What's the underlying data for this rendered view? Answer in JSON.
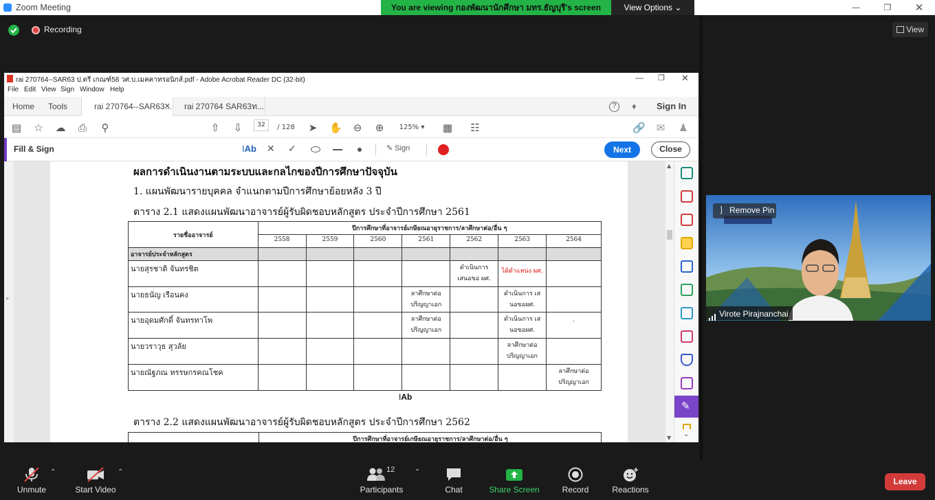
{
  "zoom": {
    "window_title": "Zoom Meeting",
    "share_banner": "You are viewing กองพัฒนานักศึกษา มทร.ธัญบุรี's screen",
    "view_options": "View Options",
    "recording_label": "Recording",
    "view_label": "View",
    "participant_name": "Virote Pirajnanchai",
    "remove_pin": "Remove Pin",
    "participants_count": "12",
    "toolbar": {
      "unmute": "Unmute",
      "start_video": "Start Video",
      "participants": "Participants",
      "chat": "Chat",
      "share_screen": "Share Screen",
      "record": "Record",
      "reactions": "Reactions",
      "leave": "Leave"
    }
  },
  "acrobat": {
    "window_title": "rai 270764--SAR63 ป.ตรี เกณฑ์58 วศ.บ.เมคคาทรอนิกส์.pdf - Adobe Acrobat Reader DC (32-bit)",
    "menu": [
      "File",
      "Edit",
      "View",
      "Sign",
      "Window",
      "Help"
    ],
    "tabs": {
      "home": "Home",
      "tools": "Tools",
      "doc1": "rai 270764--SAR63...",
      "doc2": "rai 270764 SAR63ท..."
    },
    "sign_in": "Sign In",
    "page_current": "32",
    "page_total": "/ 128",
    "zoom_level": "125%",
    "fill_sign": {
      "title": "Fill & Sign",
      "text_tool": "Ab",
      "sign_label": "Sign",
      "next": "Next",
      "close": "Close",
      "color_dot": "#e02020"
    },
    "document": {
      "heading": "ผลการดำเนินงานตามระบบและกลไกของปีการศึกษาปัจจุบัน",
      "subheading": "1.  แผนพัฒนารายบุคคล จำแนกตามปีการศึกษาย้อยหลัง 3 ปี",
      "table1_caption": "ตาราง 2.1 แสดงแผนพัฒนาอาจารย์ผู้รับผิดชอบหลักสูตร ประจำปีการศึกษา 2561",
      "table2_caption": "ตาราง 2.2 แสดงแผนพัฒนาอาจารย์ผู้รับผิดชอบหลักสูตร ประจำปีการศึกษา 2562",
      "cursor_label": "Ab",
      "table": {
        "name_header": "รายชื่ออาจารย์",
        "group_header": "ปีการศึกษาที่อาจารย์เกษียณอายุราชการ/ลาศึกษาต่อ/อื่น ๆ",
        "years": [
          "2558",
          "2559",
          "2560",
          "2561",
          "2562",
          "2563",
          "2564"
        ],
        "section_label": "อาจารย์ประจำหลักสูตร",
        "rows": [
          {
            "name": "นายสุรชาติ จันทรชิต",
            "cells": [
              "",
              "",
              "",
              "",
              "ดำเนินการ เสนอขอ ผศ.",
              "ได้ตำแหน่ง ผศ.",
              ""
            ]
          },
          {
            "name": "นายธนัญ เรือนคง",
            "cells": [
              "",
              "",
              "",
              "ลาศึกษาต่อ ปริญญาเอก",
              "",
              "ดำเนินการ เสนอขอผศ.",
              ""
            ]
          },
          {
            "name": "นายอุดมศักดิ์ จันทรทาโพ",
            "cells": [
              "",
              "",
              "",
              "ลาศึกษาต่อ ปริญญาเอก",
              "",
              "ดำเนินการ เสนอขอผศ.",
              "."
            ]
          },
          {
            "name": "นายวราวุธ สุวลัย",
            "cells": [
              "",
              "",
              "",
              "",
              "",
              "ลาศึกษาต่อ ปริญญาเอก",
              ""
            ]
          },
          {
            "name": "นายณัฐภณ หรรษกรคณโชค",
            "cells": [
              "",
              "",
              "",
              "",
              "",
              "",
              "ลาศึกษาต่อ ปริญญาเอก"
            ]
          }
        ],
        "table2_group_header": "ปีการศึกษาที่อาจารย์เกษียณอายุราชการ/ลาศึกษาต่อ/อื่น ๆ"
      }
    }
  }
}
